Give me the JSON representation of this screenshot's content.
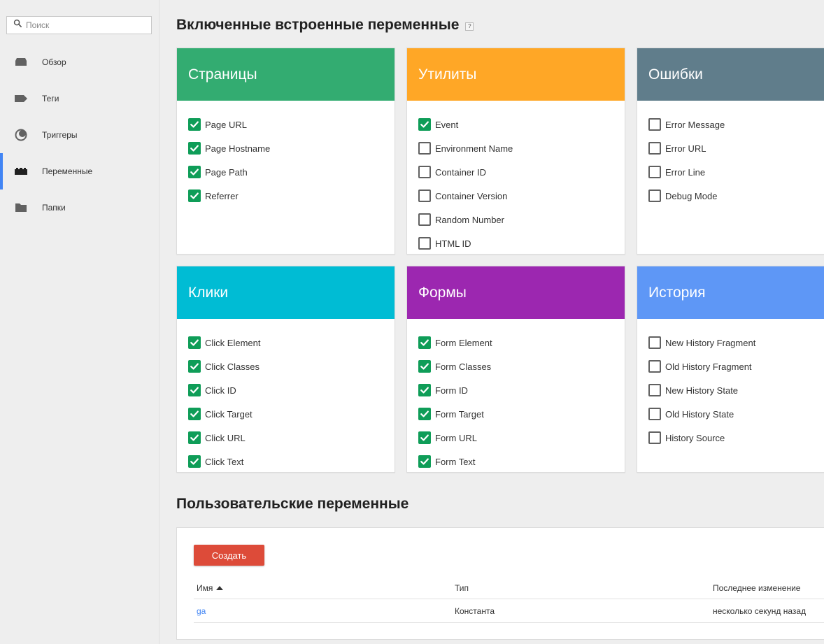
{
  "search": {
    "placeholder": "Поиск"
  },
  "nav": [
    {
      "label": "Обзор",
      "icon": "overview-icon",
      "active": false
    },
    {
      "label": "Теги",
      "icon": "tag-icon",
      "active": false
    },
    {
      "label": "Триггеры",
      "icon": "trigger-icon",
      "active": false
    },
    {
      "label": "Переменные",
      "icon": "variables-icon",
      "active": true
    },
    {
      "label": "Папки",
      "icon": "folder-icon",
      "active": false
    }
  ],
  "builtin": {
    "title": "Включенные встроенные переменные",
    "help": "?",
    "cards": [
      {
        "title": "Страницы",
        "color": "#33ac71",
        "items": [
          {
            "label": "Page URL",
            "checked": true
          },
          {
            "label": "Page Hostname",
            "checked": true
          },
          {
            "label": "Page Path",
            "checked": true
          },
          {
            "label": "Referrer",
            "checked": true
          }
        ]
      },
      {
        "title": "Утилиты",
        "color": "#ffa726",
        "items": [
          {
            "label": "Event",
            "checked": true
          },
          {
            "label": "Environment Name",
            "checked": false
          },
          {
            "label": "Container ID",
            "checked": false
          },
          {
            "label": "Container Version",
            "checked": false
          },
          {
            "label": "Random Number",
            "checked": false
          },
          {
            "label": "HTML ID",
            "checked": false
          }
        ]
      },
      {
        "title": "Ошибки",
        "color": "#607d8b",
        "items": [
          {
            "label": "Error Message",
            "checked": false
          },
          {
            "label": "Error URL",
            "checked": false
          },
          {
            "label": "Error Line",
            "checked": false
          },
          {
            "label": "Debug Mode",
            "checked": false
          }
        ]
      },
      {
        "title": "Клики",
        "color": "#00bcd4",
        "items": [
          {
            "label": "Click Element",
            "checked": true
          },
          {
            "label": "Click Classes",
            "checked": true
          },
          {
            "label": "Click ID",
            "checked": true
          },
          {
            "label": "Click Target",
            "checked": true
          },
          {
            "label": "Click URL",
            "checked": true
          },
          {
            "label": "Click Text",
            "checked": true
          }
        ]
      },
      {
        "title": "Формы",
        "color": "#9c27b0",
        "items": [
          {
            "label": "Form Element",
            "checked": true
          },
          {
            "label": "Form Classes",
            "checked": true
          },
          {
            "label": "Form ID",
            "checked": true
          },
          {
            "label": "Form Target",
            "checked": true
          },
          {
            "label": "Form URL",
            "checked": true
          },
          {
            "label": "Form Text",
            "checked": true
          }
        ]
      },
      {
        "title": "История",
        "color": "#5e97f6",
        "items": [
          {
            "label": "New History Fragment",
            "checked": false
          },
          {
            "label": "Old History Fragment",
            "checked": false
          },
          {
            "label": "New History State",
            "checked": false
          },
          {
            "label": "Old History State",
            "checked": false
          },
          {
            "label": "History Source",
            "checked": false
          }
        ]
      }
    ]
  },
  "custom": {
    "title": "Пользовательские переменные",
    "create_label": "Создать",
    "columns": [
      "Имя",
      "Тип",
      "Последнее изменение"
    ],
    "rows": [
      {
        "name": "ga",
        "type": "Константа",
        "modified": "несколько секунд назад"
      }
    ]
  }
}
